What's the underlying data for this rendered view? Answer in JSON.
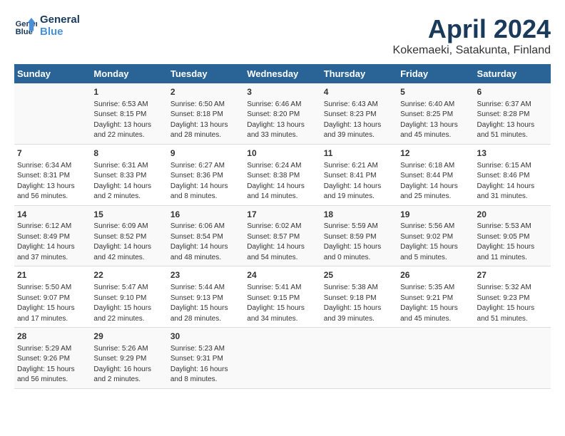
{
  "logo": {
    "line1": "General",
    "line2": "Blue"
  },
  "title": "April 2024",
  "subtitle": "Kokemaeki, Satakunta, Finland",
  "days_header": [
    "Sunday",
    "Monday",
    "Tuesday",
    "Wednesday",
    "Thursday",
    "Friday",
    "Saturday"
  ],
  "weeks": [
    [
      {
        "day": "",
        "content": ""
      },
      {
        "day": "1",
        "content": "Sunrise: 6:53 AM\nSunset: 8:15 PM\nDaylight: 13 hours\nand 22 minutes."
      },
      {
        "day": "2",
        "content": "Sunrise: 6:50 AM\nSunset: 8:18 PM\nDaylight: 13 hours\nand 28 minutes."
      },
      {
        "day": "3",
        "content": "Sunrise: 6:46 AM\nSunset: 8:20 PM\nDaylight: 13 hours\nand 33 minutes."
      },
      {
        "day": "4",
        "content": "Sunrise: 6:43 AM\nSunset: 8:23 PM\nDaylight: 13 hours\nand 39 minutes."
      },
      {
        "day": "5",
        "content": "Sunrise: 6:40 AM\nSunset: 8:25 PM\nDaylight: 13 hours\nand 45 minutes."
      },
      {
        "day": "6",
        "content": "Sunrise: 6:37 AM\nSunset: 8:28 PM\nDaylight: 13 hours\nand 51 minutes."
      }
    ],
    [
      {
        "day": "7",
        "content": "Sunrise: 6:34 AM\nSunset: 8:31 PM\nDaylight: 13 hours\nand 56 minutes."
      },
      {
        "day": "8",
        "content": "Sunrise: 6:31 AM\nSunset: 8:33 PM\nDaylight: 14 hours\nand 2 minutes."
      },
      {
        "day": "9",
        "content": "Sunrise: 6:27 AM\nSunset: 8:36 PM\nDaylight: 14 hours\nand 8 minutes."
      },
      {
        "day": "10",
        "content": "Sunrise: 6:24 AM\nSunset: 8:38 PM\nDaylight: 14 hours\nand 14 minutes."
      },
      {
        "day": "11",
        "content": "Sunrise: 6:21 AM\nSunset: 8:41 PM\nDaylight: 14 hours\nand 19 minutes."
      },
      {
        "day": "12",
        "content": "Sunrise: 6:18 AM\nSunset: 8:44 PM\nDaylight: 14 hours\nand 25 minutes."
      },
      {
        "day": "13",
        "content": "Sunrise: 6:15 AM\nSunset: 8:46 PM\nDaylight: 14 hours\nand 31 minutes."
      }
    ],
    [
      {
        "day": "14",
        "content": "Sunrise: 6:12 AM\nSunset: 8:49 PM\nDaylight: 14 hours\nand 37 minutes."
      },
      {
        "day": "15",
        "content": "Sunrise: 6:09 AM\nSunset: 8:52 PM\nDaylight: 14 hours\nand 42 minutes."
      },
      {
        "day": "16",
        "content": "Sunrise: 6:06 AM\nSunset: 8:54 PM\nDaylight: 14 hours\nand 48 minutes."
      },
      {
        "day": "17",
        "content": "Sunrise: 6:02 AM\nSunset: 8:57 PM\nDaylight: 14 hours\nand 54 minutes."
      },
      {
        "day": "18",
        "content": "Sunrise: 5:59 AM\nSunset: 8:59 PM\nDaylight: 15 hours\nand 0 minutes."
      },
      {
        "day": "19",
        "content": "Sunrise: 5:56 AM\nSunset: 9:02 PM\nDaylight: 15 hours\nand 5 minutes."
      },
      {
        "day": "20",
        "content": "Sunrise: 5:53 AM\nSunset: 9:05 PM\nDaylight: 15 hours\nand 11 minutes."
      }
    ],
    [
      {
        "day": "21",
        "content": "Sunrise: 5:50 AM\nSunset: 9:07 PM\nDaylight: 15 hours\nand 17 minutes."
      },
      {
        "day": "22",
        "content": "Sunrise: 5:47 AM\nSunset: 9:10 PM\nDaylight: 15 hours\nand 22 minutes."
      },
      {
        "day": "23",
        "content": "Sunrise: 5:44 AM\nSunset: 9:13 PM\nDaylight: 15 hours\nand 28 minutes."
      },
      {
        "day": "24",
        "content": "Sunrise: 5:41 AM\nSunset: 9:15 PM\nDaylight: 15 hours\nand 34 minutes."
      },
      {
        "day": "25",
        "content": "Sunrise: 5:38 AM\nSunset: 9:18 PM\nDaylight: 15 hours\nand 39 minutes."
      },
      {
        "day": "26",
        "content": "Sunrise: 5:35 AM\nSunset: 9:21 PM\nDaylight: 15 hours\nand 45 minutes."
      },
      {
        "day": "27",
        "content": "Sunrise: 5:32 AM\nSunset: 9:23 PM\nDaylight: 15 hours\nand 51 minutes."
      }
    ],
    [
      {
        "day": "28",
        "content": "Sunrise: 5:29 AM\nSunset: 9:26 PM\nDaylight: 15 hours\nand 56 minutes."
      },
      {
        "day": "29",
        "content": "Sunrise: 5:26 AM\nSunset: 9:29 PM\nDaylight: 16 hours\nand 2 minutes."
      },
      {
        "day": "30",
        "content": "Sunrise: 5:23 AM\nSunset: 9:31 PM\nDaylight: 16 hours\nand 8 minutes."
      },
      {
        "day": "",
        "content": ""
      },
      {
        "day": "",
        "content": ""
      },
      {
        "day": "",
        "content": ""
      },
      {
        "day": "",
        "content": ""
      }
    ]
  ]
}
